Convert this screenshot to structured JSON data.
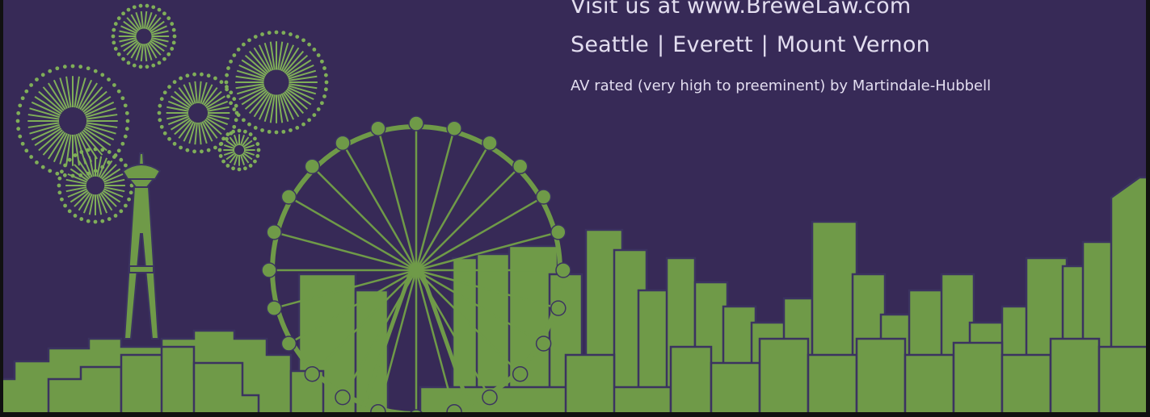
{
  "ad": {
    "website_line": "Visit us at www.BreweLaw.com",
    "offices": [
      "Seattle",
      "Everett",
      "Mount Vernon"
    ],
    "office_separator": "|",
    "rating_line": "AV rated (very high to preeminent) by Martindale-Hubbell"
  },
  "colors": {
    "background": "#3a2d5a",
    "skyline_fill": "#6f9a48",
    "skyline_stroke": "#3b3360",
    "firework": "#7fae58",
    "text": "#e3def0"
  },
  "illustration": {
    "icons": [
      "fireworks-icon",
      "space-needle-icon",
      "ferris-wheel-icon",
      "city-skyline-icon"
    ]
  }
}
